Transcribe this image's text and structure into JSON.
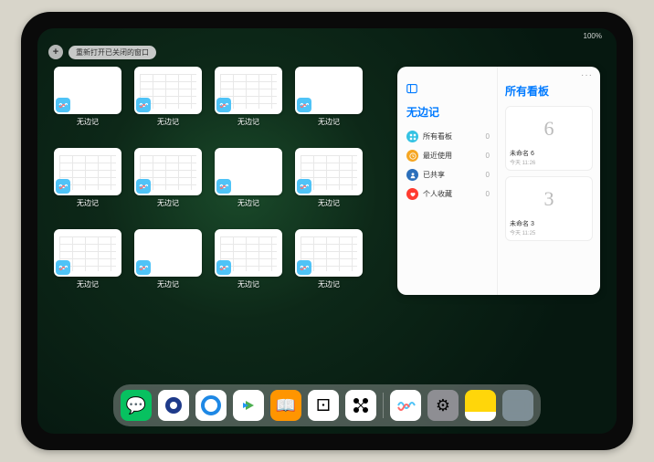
{
  "status": {
    "right_text": "100%"
  },
  "top": {
    "plus": "+",
    "reopen_label": "重新打开已关闭的窗口"
  },
  "thumbnails": [
    {
      "label": "无边记",
      "variant": "blank"
    },
    {
      "label": "无边记",
      "variant": "calendar"
    },
    {
      "label": "无边记",
      "variant": "calendar"
    },
    {
      "label": "无边记",
      "variant": "blank"
    },
    {
      "label": "无边记",
      "variant": "calendar"
    },
    {
      "label": "无边记",
      "variant": "calendar"
    },
    {
      "label": "无边记",
      "variant": "blank"
    },
    {
      "label": "无边记",
      "variant": "calendar"
    },
    {
      "label": "无边记",
      "variant": "calendar"
    },
    {
      "label": "无边记",
      "variant": "blank"
    },
    {
      "label": "无边记",
      "variant": "calendar"
    },
    {
      "label": "无边记",
      "variant": "calendar"
    }
  ],
  "panel": {
    "more": "···",
    "left_title": "无边记",
    "items": [
      {
        "icon": "square-grid",
        "bg": "#34c2e3",
        "label": "所有看板",
        "count": "0"
      },
      {
        "icon": "clock",
        "bg": "#f5a623",
        "label": "最近使用",
        "count": "0"
      },
      {
        "icon": "person",
        "bg": "#2c6fbb",
        "label": "已共享",
        "count": "0"
      },
      {
        "icon": "heart",
        "bg": "#ff3b30",
        "label": "个人收藏",
        "count": "0"
      }
    ],
    "right_title": "所有看板",
    "boards": [
      {
        "drawing": "6",
        "name": "未命名 6",
        "time": "今天 11:26"
      },
      {
        "drawing": "3",
        "name": "未命名 3",
        "time": "今天 11:25"
      }
    ]
  },
  "dock": {
    "apps": [
      {
        "name": "wechat",
        "bg": "#07c160",
        "glyph": "💬"
      },
      {
        "name": "browser1",
        "bg": "#ffffff",
        "glyph": ""
      },
      {
        "name": "browser2",
        "bg": "#ffffff",
        "glyph": ""
      },
      {
        "name": "video",
        "bg": "#ffffff",
        "glyph": "▶"
      },
      {
        "name": "books",
        "bg": "#ff9500",
        "glyph": "📖"
      },
      {
        "name": "dice",
        "bg": "#ffffff",
        "glyph": "⚀"
      },
      {
        "name": "connect",
        "bg": "#ffffff",
        "glyph": "⋈"
      }
    ],
    "recent": [
      {
        "name": "freeform",
        "bg": "#ffffff",
        "glyph": "〰"
      },
      {
        "name": "settings",
        "bg": "#8e8e93",
        "glyph": "⚙"
      },
      {
        "name": "notes",
        "bg": "#ffd60a",
        "glyph": ""
      }
    ]
  }
}
